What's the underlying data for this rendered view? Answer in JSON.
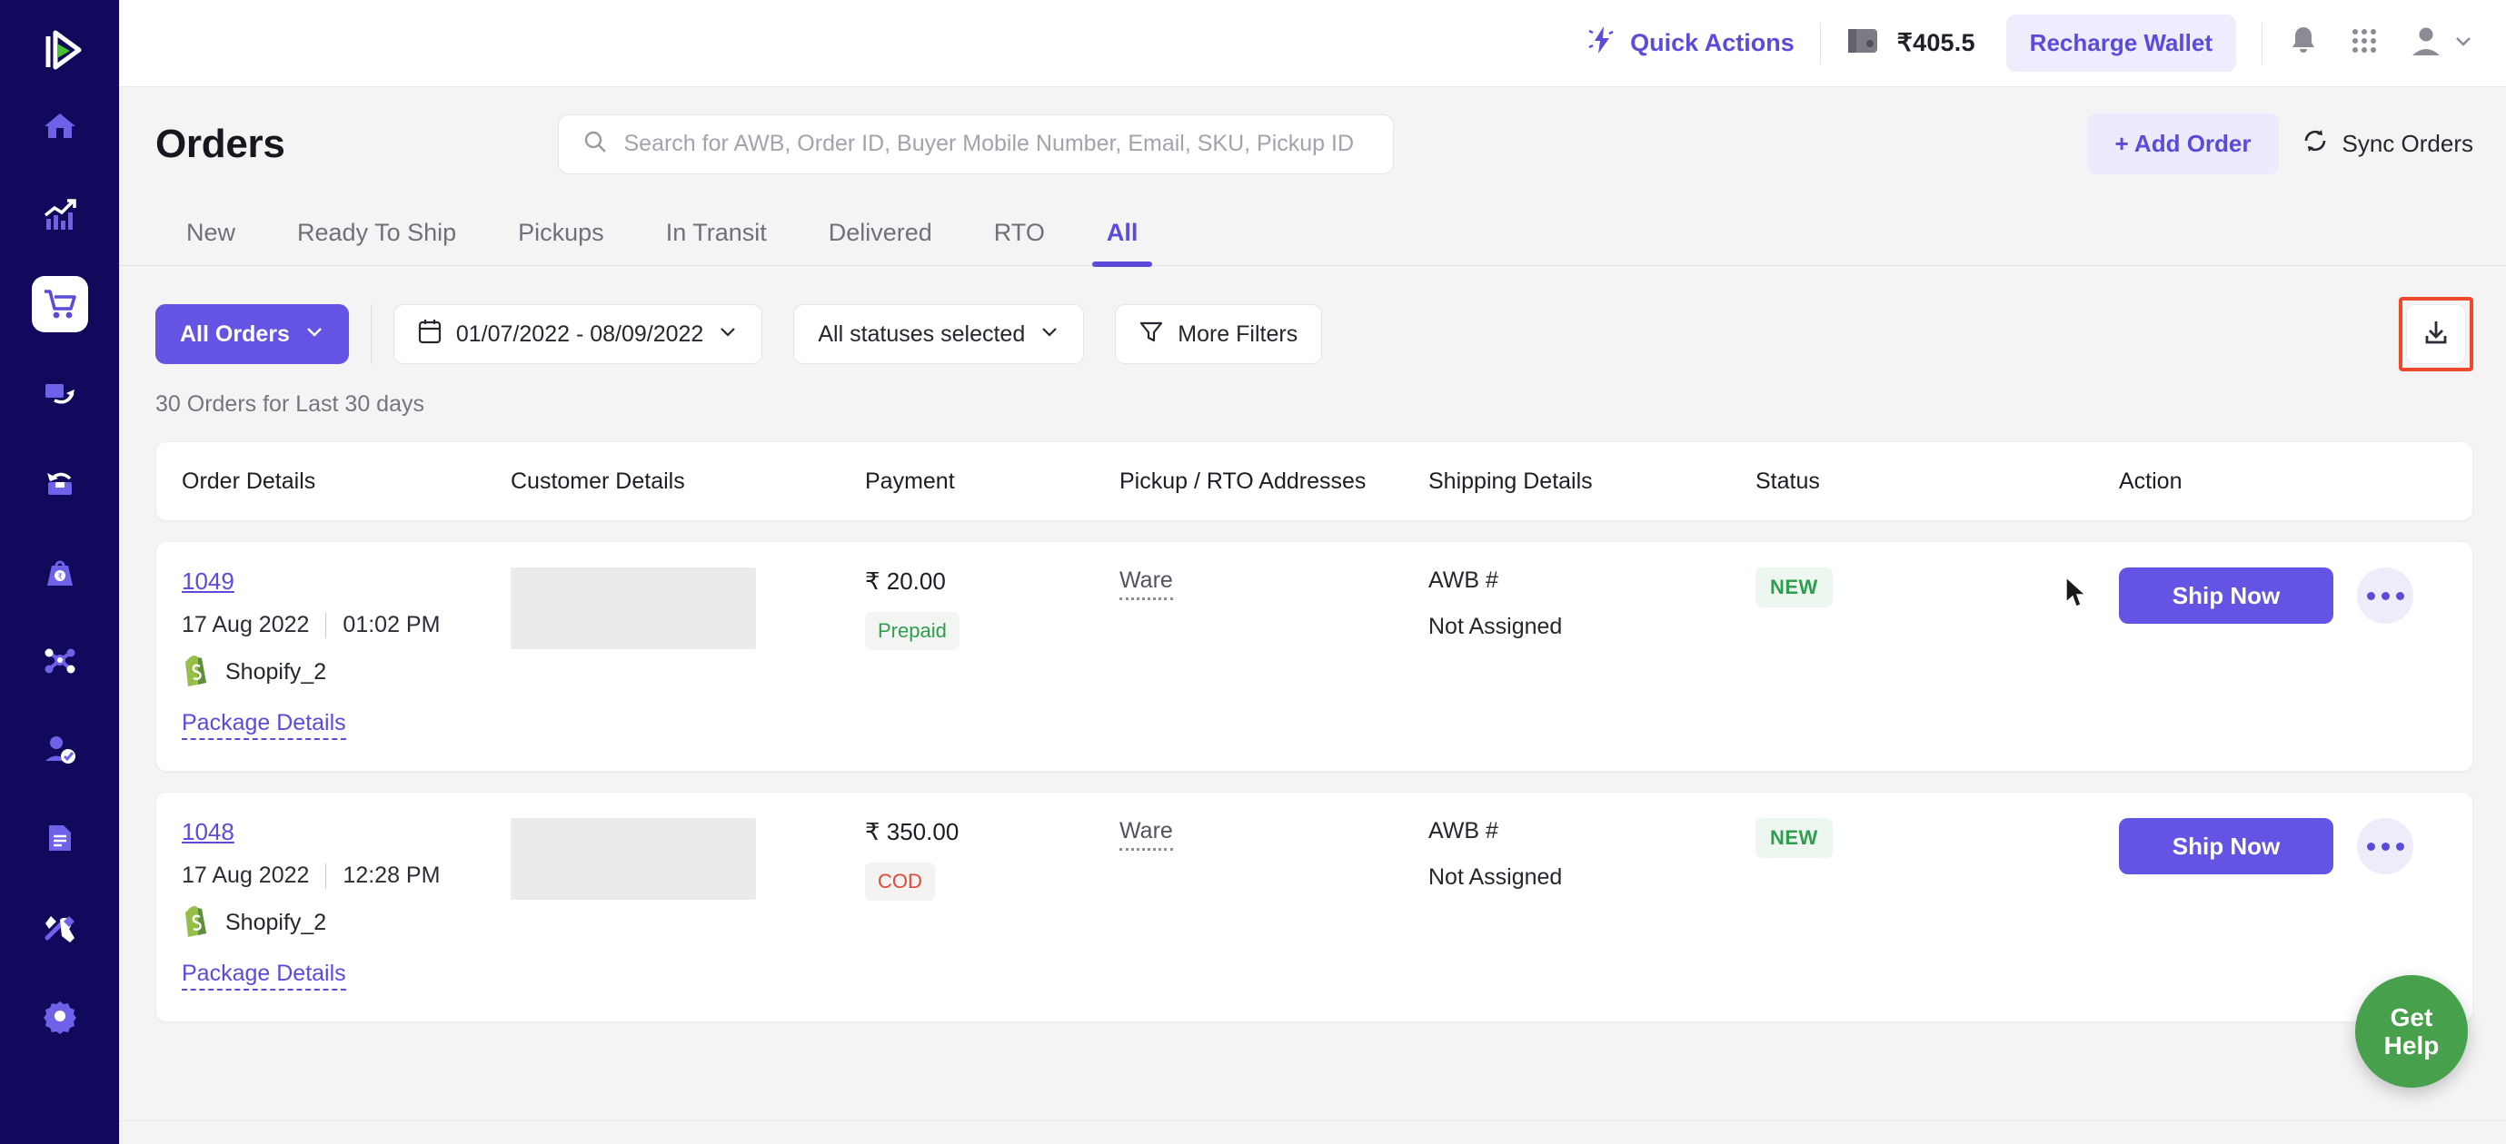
{
  "brand": {
    "logo_name": "shiprocket-logo",
    "sidebar_bg": "#110a5c",
    "accent": "#5b4bdb",
    "accent_solid": "#6354e4"
  },
  "sidebar": {
    "items": [
      {
        "name": "home",
        "icon": "home-icon",
        "active": false
      },
      {
        "name": "analytics",
        "icon": "chart-growth-icon",
        "active": false
      },
      {
        "name": "orders",
        "icon": "shopping-cart-icon",
        "active": true
      },
      {
        "name": "returns",
        "icon": "return-arrow-icon",
        "active": false
      },
      {
        "name": "ndr",
        "icon": "undo-box-icon",
        "active": false
      },
      {
        "name": "weight",
        "icon": "weight-rupee-icon",
        "active": false
      },
      {
        "name": "channels",
        "icon": "network-nodes-icon",
        "active": false
      },
      {
        "name": "buyer",
        "icon": "user-check-icon",
        "active": false
      },
      {
        "name": "billing",
        "icon": "document-lines-icon",
        "active": false
      },
      {
        "name": "tools",
        "icon": "hammer-wrench-icon",
        "active": false
      },
      {
        "name": "settings",
        "icon": "gear-icon",
        "active": false
      }
    ]
  },
  "topbar": {
    "quick_actions_label": "Quick Actions",
    "quick_actions_icon": "lightning-bolt-icon",
    "wallet_icon": "wallet-icon",
    "wallet_balance": "₹405.5",
    "recharge_label": "Recharge Wallet",
    "notification_icon": "bell-icon",
    "apps_icon": "grid-apps-icon",
    "avatar_icon": "user-avatar-icon",
    "avatar_chevron_icon": "chevron-down-icon"
  },
  "header": {
    "title": "Orders",
    "search": {
      "icon": "search-icon",
      "placeholder": "Search for AWB, Order ID, Buyer Mobile Number, Email, SKU, Pickup ID",
      "value": ""
    },
    "add_order_label": "+ Add Order",
    "sync_orders_label": "Sync Orders",
    "sync_icon": "refresh-circle-icon"
  },
  "tabs": [
    {
      "label": "New",
      "active": false
    },
    {
      "label": "Ready To Ship",
      "active": false
    },
    {
      "label": "Pickups",
      "active": false
    },
    {
      "label": "In Transit",
      "active": false
    },
    {
      "label": "Delivered",
      "active": false
    },
    {
      "label": "RTO",
      "active": false
    },
    {
      "label": "All",
      "active": true
    }
  ],
  "filters": {
    "all_orders_label": "All Orders",
    "all_orders_chevron": "chevron-down-icon",
    "date_range": "01/07/2022 - 08/09/2022",
    "calendar_icon": "calendar-icon",
    "date_chevron": "chevron-down-icon",
    "status_label": "All statuses selected",
    "status_chevron": "chevron-down-icon",
    "more_filters_label": "More Filters",
    "more_filters_icon": "funnel-filter-icon",
    "download_icon": "download-icon",
    "download_highlight_color": "#ec4a2a"
  },
  "summary": {
    "count_text": "30 Orders for Last 30 days"
  },
  "table": {
    "columns": [
      "Order Details",
      "Customer Details",
      "Payment",
      "Pickup / RTO Addresses",
      "Shipping Details",
      "Status",
      "Action"
    ],
    "rows": [
      {
        "order_id": "1049",
        "date": "17 Aug 2022",
        "time": "01:02 PM",
        "channel_icon": "shopify-icon",
        "channel": "Shopify_2",
        "package_details_label": "Package Details",
        "customer": "",
        "amount": "₹ 20.00",
        "payment_tag": "Prepaid",
        "payment_tag_type": "prepaid",
        "pickup_address": "Ware",
        "awb_label": "AWB #",
        "awb_value": "Not Assigned",
        "status": "NEW",
        "action_label": "Ship Now",
        "more_icon": "three-dots-icon"
      },
      {
        "order_id": "1048",
        "date": "17 Aug 2022",
        "time": "12:28 PM",
        "channel_icon": "shopify-icon",
        "channel": "Shopify_2",
        "package_details_label": "Package Details",
        "customer": "",
        "amount": "₹ 350.00",
        "payment_tag": "COD",
        "payment_tag_type": "cod",
        "pickup_address": "Ware",
        "awb_label": "AWB #",
        "awb_value": "Not Assigned",
        "status": "NEW",
        "action_label": "Ship Now",
        "more_icon": "three-dots-icon"
      }
    ]
  },
  "help": {
    "label_line1": "Get",
    "label_line2": "Help"
  }
}
